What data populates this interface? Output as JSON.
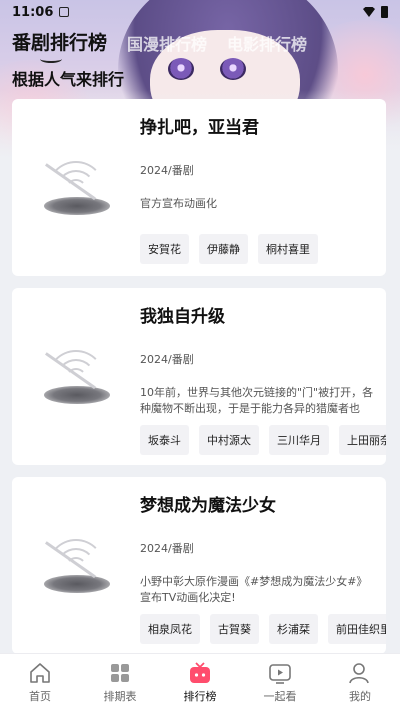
{
  "status_bar": {
    "time": "11:06"
  },
  "tabs": [
    {
      "label": "番剧排行榜"
    },
    {
      "label": "国漫排行榜"
    },
    {
      "label": "电影排行榜"
    }
  ],
  "subtitle": "根据人气来排行",
  "cards": [
    {
      "title": "挣扎吧，亚当君",
      "meta": "2024/番剧",
      "desc": "官方宣布动画化",
      "tags": [
        "安賀花",
        "伊藤静",
        "桐村喜里"
      ]
    },
    {
      "title": "我独自升级",
      "meta": "2024/番剧",
      "desc": "10年前，世界与其他次元链接的\"门\"被打开，各种魔物不断出现，于是于能力各异的猎魔者也随…",
      "tags": [
        "坂泰斗",
        "中村源太",
        "三川华月",
        "上田丽奈"
      ]
    },
    {
      "title": "梦想成为魔法少女",
      "meta": "2024/番剧",
      "desc": "小野中彰大原作漫画《#梦想成为魔法少女#》宣布TV动画化决定!",
      "tags": [
        "相泉凤花",
        "古賀葵",
        "杉浦栞",
        "前田佳织里"
      ]
    }
  ],
  "nav": [
    {
      "label": "首页",
      "icon": "home-icon"
    },
    {
      "label": "排期表",
      "icon": "grid-icon"
    },
    {
      "label": "排行榜",
      "icon": "tv-icon"
    },
    {
      "label": "一起看",
      "icon": "play-screen-icon"
    },
    {
      "label": "我的",
      "icon": "user-icon"
    }
  ],
  "colors": {
    "accent": "#ff4d6d",
    "tag_bg": "#f2f2f5",
    "page_bg": "#eef0f4"
  }
}
